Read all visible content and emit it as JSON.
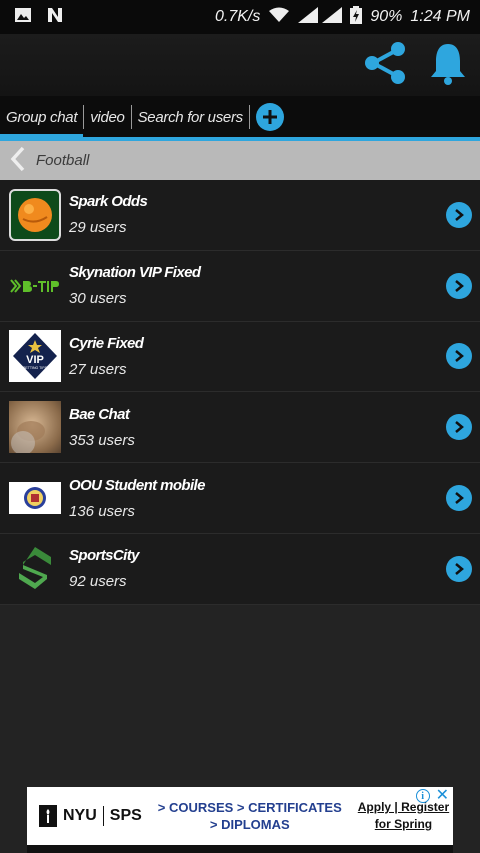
{
  "status_bar": {
    "speed": "0.7K/s",
    "battery": "90%",
    "time": "1:24 PM",
    "icons": [
      "image-icon",
      "n-icon",
      "wifi-icon",
      "signal-icon",
      "battery-icon"
    ]
  },
  "app_bar": {
    "icons": [
      "share-icon",
      "bell-icon"
    ],
    "accent": "#2ea6de"
  },
  "tabs": [
    {
      "label": "Group chat",
      "active": true
    },
    {
      "label": "video",
      "active": false
    },
    {
      "label": "Search for users",
      "active": false
    }
  ],
  "breadcrumb": {
    "label": "Football",
    "icon": "chevron-left-icon"
  },
  "groups": [
    {
      "name": "Spark Odds",
      "count": "29 users",
      "icon": "soccer-ball-icon"
    },
    {
      "name": "Skynation VIP Fixed",
      "count": "30 users",
      "icon": "btip-logo-icon"
    },
    {
      "name": "Cyrie Fixed",
      "count": "27 users",
      "icon": "vip-badge-icon",
      "badge_text": "VIP",
      "badge_small": "BETTING TIPS"
    },
    {
      "name": "Bae Chat",
      "count": "353 users",
      "icon": "photo-icon"
    },
    {
      "name": "OOU Student mobile",
      "count": "136 users",
      "icon": "crest-icon"
    },
    {
      "name": "SportsCity",
      "count": "92 users",
      "icon": "s-logo-icon"
    }
  ],
  "ad": {
    "brand_left": "NYU",
    "brand_right": "SPS",
    "line1": "> COURSES > CERTIFICATES",
    "line2": "> DIPLOMAS",
    "cta1": "Apply | Register",
    "cta2": "for Spring",
    "icons": [
      "info-icon",
      "close-icon"
    ]
  }
}
